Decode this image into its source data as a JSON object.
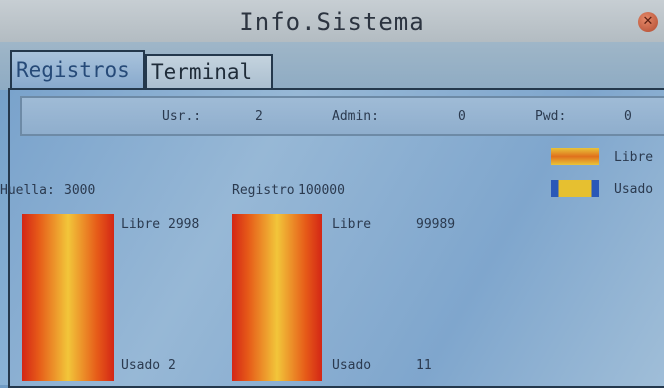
{
  "window": {
    "title": "Info.Sistema",
    "close_icon": "close-icon"
  },
  "tabs": [
    {
      "label": "Registros",
      "active": true
    },
    {
      "label": "Terminal",
      "active": false
    }
  ],
  "stats": {
    "usr_label": "Usr.:",
    "usr_value": "2",
    "admin_label": "Admin:",
    "admin_value": "0",
    "pwd_label": "Pwd:",
    "pwd_value": "0"
  },
  "legend": {
    "libre_label": "Libre",
    "usado_label": "Usado"
  },
  "huella": {
    "label": "Huella:",
    "total": "3000",
    "libre_label": "Libre",
    "libre_value": "2998",
    "usado_label": "Usado",
    "usado_value": "2"
  },
  "registro": {
    "label": "Registro",
    "total": "100000",
    "libre_label": "Libre",
    "libre_value": "99989",
    "usado_label": "Usado",
    "usado_value": "11"
  },
  "colors": {
    "bar_edge": "#d32616",
    "bar_center": "#f2c63a",
    "usado_blue": "#2a58b8",
    "tab_active_text": "#264a78"
  }
}
